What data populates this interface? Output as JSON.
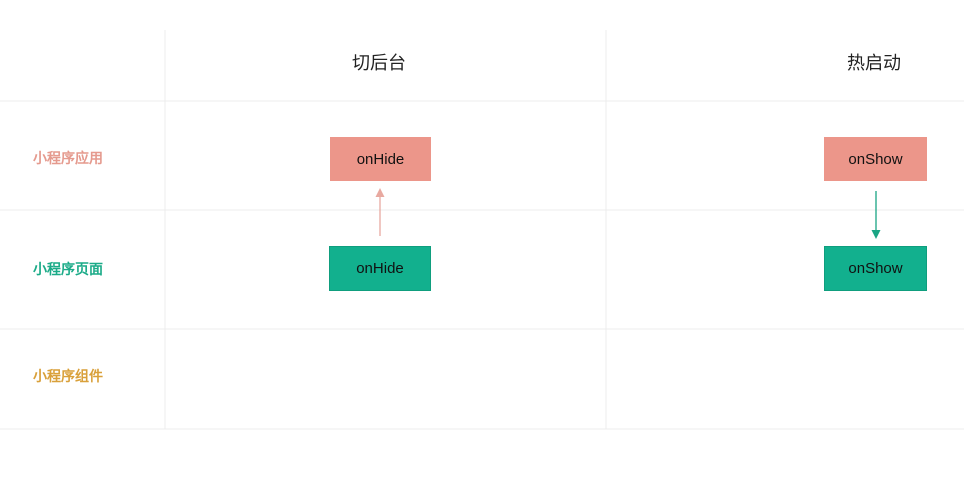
{
  "columns": {
    "background": "切后台",
    "hot_start": "热启动"
  },
  "rows": {
    "app": {
      "label": "小程序应用",
      "color": "#e59a8e"
    },
    "page": {
      "label": "小程序页面",
      "color": "#1bab88"
    },
    "component": {
      "label": "小程序组件",
      "color": "#d9a03a"
    }
  },
  "nodes": {
    "background_app": "onHide",
    "background_page": "onHide",
    "hot_app": "onShow",
    "hot_page": "onShow"
  },
  "colors": {
    "app_box": "#ec968a",
    "page_box": "#12b08e",
    "page_box_border": "#0f9e7e",
    "arrow_up": "#e8a9a0",
    "arrow_down": "#1aa584",
    "grid_line": "#ececec"
  }
}
